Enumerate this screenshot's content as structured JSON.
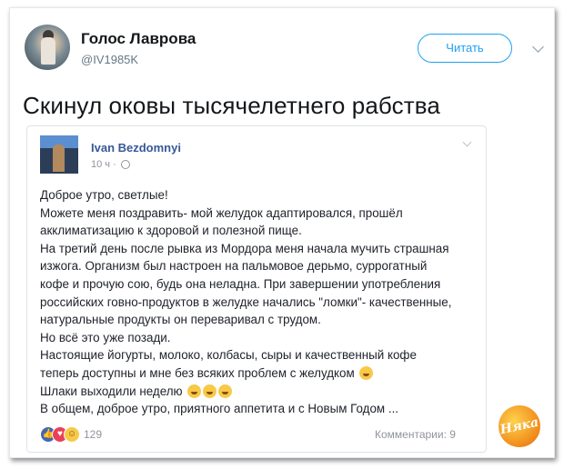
{
  "tweet": {
    "author_name": "Голос Лаврова",
    "author_handle": "@IV1985K",
    "follow_label": "Читать",
    "text": "Скинул оковы тысячелетнего рабства"
  },
  "fb_post": {
    "author_name": "Ivan Bezdomnyi",
    "time": "10 ч ·",
    "lines": [
      "Доброе утро, светлые!",
      "Можете меня поздравить- мой желудок адаптировался, прошёл",
      "акклиматизацию к здоровой и полезной пище.",
      "На третий день после рывка из Мордора меня начала мучить страшная",
      "изжога. Организм был настроен на пальмовое дерьмо, суррогатный",
      "кофе и прочую сою, будь она неладна. При завершении употребления",
      "российских говно-продуктов в желудке начались \"ломки\"- качественные,",
      "натуральные продукты он переваривал с трудом.",
      "Но всё это уже позади.",
      "Настоящие йогурты, молоко, колбасы, сыры и качественный кофе",
      "теперь доступны и мне без всяких проблем с желудком",
      "Шлаки выходили неделю",
      "В общем, доброе утро, приятного аппетита и с Новым Годом ..."
    ],
    "reaction_count": "129",
    "comments": "Комментарии: 9"
  },
  "watermark": "Няка",
  "icons": {
    "menu": "chevron-down-icon",
    "privacy": "globe-icon",
    "reactions": [
      "like-icon",
      "love-icon",
      "haha-icon"
    ],
    "emoji": "smile-emoji-icon"
  },
  "colors": {
    "twitter_blue": "#1da1f2",
    "facebook_link": "#365899",
    "secondary_text": "#90949c"
  }
}
